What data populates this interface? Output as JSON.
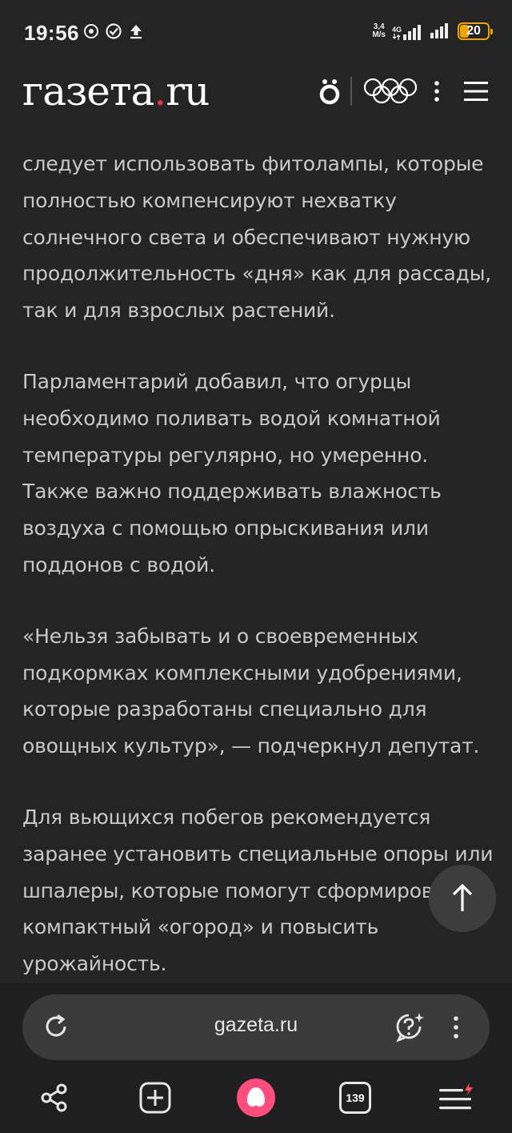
{
  "status_bar": {
    "time": "19:56",
    "net_speed_value": "3,4",
    "net_speed_unit": "M/s",
    "network_type": "4G",
    "battery_level": "20"
  },
  "header": {
    "logo_text": "газета",
    "logo_dot": ".",
    "logo_tld": "ru"
  },
  "article": {
    "paragraphs": [
      "следует использовать фитолампы, которые полностью компенсируют нехватку солнечного света и обеспечивают нужную продолжительность «дня» как для рассады, так и для взрослых растений.",
      "Парламентарий добавил, что огурцы необходимо поливать водой комнатной температуры регулярно, но умеренно. Также важно поддерживать влажность воздуха с помощью опрыскивания или поддонов с водой.",
      "«Нельзя забывать и о своевременных подкормках комплексными удобрениями, которые разработаны специально для овощных культур», — подчеркнул депутат.",
      "Для вьющихся побегов рекомендуется заранее установить специальные опоры или шпалеры, которые помогут сформировать компактный «огород» и повысить урожайность."
    ]
  },
  "browser": {
    "url": "gazeta.ru",
    "tabs_count": "139"
  },
  "colors": {
    "background": "#242424",
    "text": "#c8c8c8",
    "accent_red": "#e8343c",
    "assistant_pink": "#ff4d7d",
    "battery_orange": "#f0a400"
  },
  "icons": [
    "sync-icon",
    "check-circle-icon",
    "upload-icon",
    "signal-icon",
    "battery-icon",
    "o-umlaut-icon",
    "olympic-rings-icon",
    "kebab-menu-icon",
    "hamburger-menu-icon",
    "arrow-up-icon",
    "reload-icon",
    "ai-question-icon",
    "share-icon",
    "new-tab-icon",
    "alice-assistant-icon",
    "tabs-icon"
  ]
}
